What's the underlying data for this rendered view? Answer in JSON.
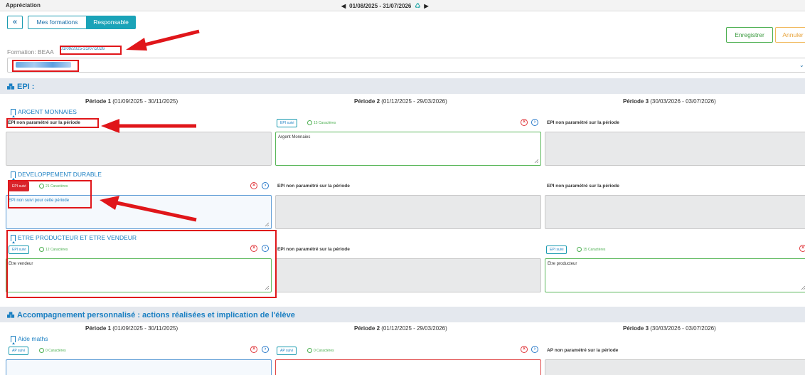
{
  "header": {
    "app_title": "Appréciation",
    "date_range": "01/08/2025 - 31/07/2026"
  },
  "toolbar": {
    "back_label": "«",
    "tab_mes": "Mes formations",
    "tab_resp": "Responsable",
    "save_label": "Enregistrer",
    "cancel_label": "Annuler"
  },
  "formation": {
    "label": "Formation: BEAA",
    "dates": "01/09/2025-31/07/2026"
  },
  "epi_section": {
    "title": "EPI :",
    "periods": [
      {
        "name": "Période 1",
        "dates": "(01/09/2025 - 30/11/2025)"
      },
      {
        "name": "Période 2",
        "dates": "(01/12/2025 - 29/03/2026)"
      },
      {
        "name": "Période 3",
        "dates": "(30/03/2026 - 03/07/2026)"
      }
    ],
    "rows": [
      {
        "name": "ARGENT MONNAIES",
        "p1_notset": "EPI non paramétré sur la période",
        "p2_badge": "EPI suivi",
        "p2_chars": "15 Caractères",
        "p2_text": "Argent Monnaies",
        "p3_notset": "EPI non paramétré sur la période"
      },
      {
        "name": "DEVELOPPEMENT DURABLE",
        "p1_badge": "EPI suivi",
        "p1_chars": "21 Caractères",
        "p1_text": "EPI non suivi pour cette période",
        "p2_notset": "EPI non paramétré sur la période",
        "p3_notset": "EPI non paramétré sur la période"
      },
      {
        "name": "ETRE PRODUCTEUR ET ETRE VENDEUR",
        "p1_badge": "EPI suivi",
        "p1_chars": "12 Caractères",
        "p1_text": "Etre vendeur",
        "p2_notset": "EPI non paramétré sur la période",
        "p3_badge": "EPI suivi",
        "p3_chars": "15 Caractères",
        "p3_text": "Etre producteur"
      }
    ]
  },
  "ap_section": {
    "title": "Accompagnement personnalisé : actions réalisées et implication de l'élève",
    "periods": [
      {
        "name": "Période 1",
        "dates": "(01/09/2025 - 30/11/2025)"
      },
      {
        "name": "Période 2",
        "dates": "(01/12/2025 - 29/03/2026)"
      },
      {
        "name": "Période 3",
        "dates": "(30/03/2026 - 03/07/2026)"
      }
    ],
    "rows": [
      {
        "name": "Aide maths",
        "p1_badge": "AP suivi",
        "p1_chars": "0 Caractères",
        "p2_badge": "AP suivi",
        "p2_chars": "0 Caractères",
        "p3_notset": "AP non paramétré sur la période"
      }
    ]
  },
  "colors": {
    "accent": "#1aa3b8",
    "link": "#1a7fc2",
    "annotation": "#e0161a",
    "ok": "#4caf50"
  }
}
